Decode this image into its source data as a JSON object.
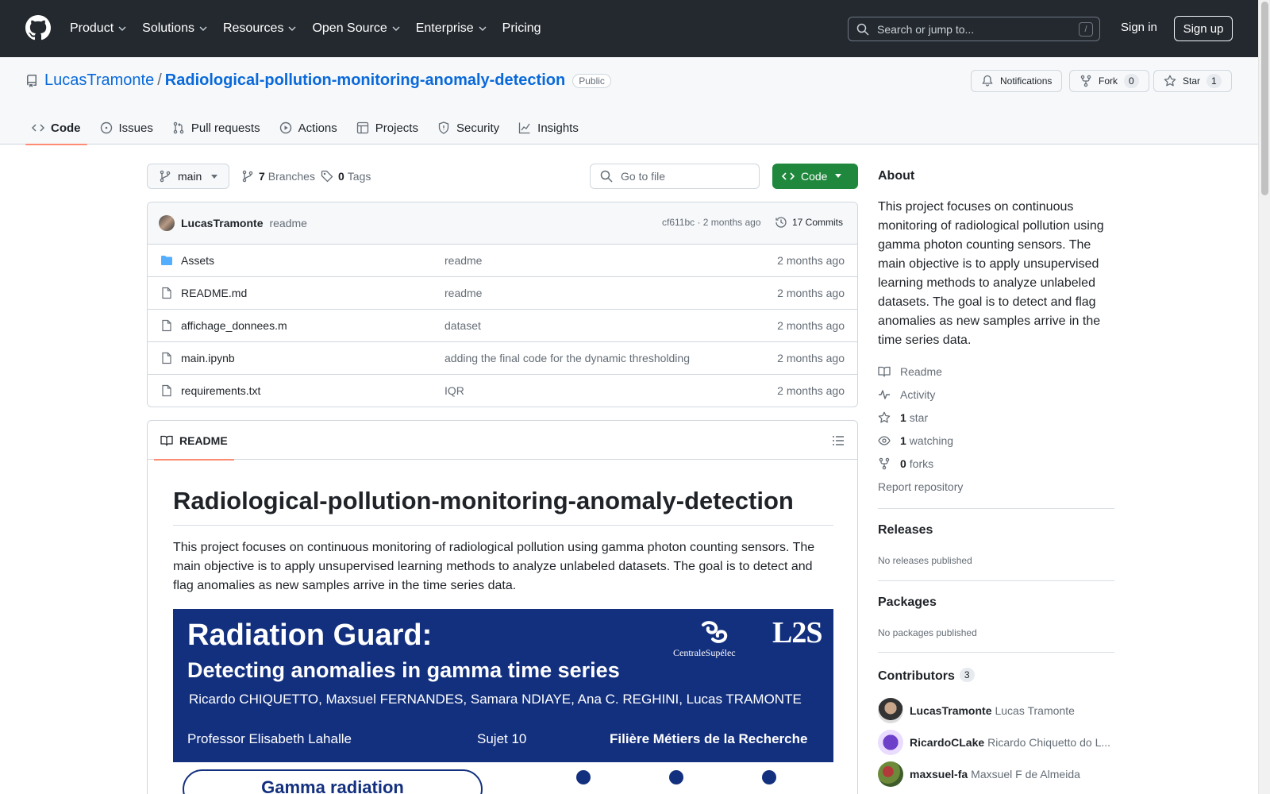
{
  "nav": {
    "items": [
      "Product",
      "Solutions",
      "Resources",
      "Open Source",
      "Enterprise",
      "Pricing"
    ],
    "search_placeholder": "Search or jump to...",
    "search_shortcut": "/",
    "signin": "Sign in",
    "signup": "Sign up"
  },
  "repo": {
    "owner": "LucasTramonte",
    "separator": "/",
    "name": "Radiological-pollution-monitoring-anomaly-detection",
    "visibility": "Public",
    "notifications_label": "Notifications",
    "fork_label": "Fork",
    "fork_count": "0",
    "star_label": "Star",
    "star_count": "1"
  },
  "tabs": [
    "Code",
    "Issues",
    "Pull requests",
    "Actions",
    "Projects",
    "Security",
    "Insights"
  ],
  "toolbar": {
    "branch": "main",
    "branches_count": "7",
    "branches_label": "Branches",
    "tags_count": "0",
    "tags_label": "Tags",
    "goto_placeholder": "Go to file",
    "code_label": "Code"
  },
  "commit": {
    "author": "LucasTramonte",
    "message": "readme",
    "hash_time": "cf611bc · 2 months ago",
    "commits_label": "17 Commits"
  },
  "files": [
    {
      "name": "Assets",
      "type": "folder",
      "message": "readme",
      "date": "2 months ago"
    },
    {
      "name": "README.md",
      "type": "file",
      "message": "readme",
      "date": "2 months ago"
    },
    {
      "name": "affichage_donnees.m",
      "type": "file",
      "message": "dataset",
      "date": "2 months ago"
    },
    {
      "name": "main.ipynb",
      "type": "file",
      "message": "adding the final code for the dynamic thresholding",
      "date": "2 months ago"
    },
    {
      "name": "requirements.txt",
      "type": "file",
      "message": "IQR",
      "date": "2 months ago"
    }
  ],
  "readme": {
    "tab_label": "README",
    "title": "Radiological-pollution-monitoring-anomaly-detection",
    "paragraph": "This project focuses on continuous monitoring of radiological pollution using gamma photon counting sensors. The main objective is to apply unsupervised learning methods to analyze unlabeled datasets. The goal is to detect and flag anomalies as new samples arrive in the time series data.",
    "banner": {
      "title": "Radiation Guard:",
      "subtitle": "Detecting anomalies in gamma time series",
      "authors": "Ricardo CHIQUETTO, Maxsuel FERNANDES, Samara NDIAYE, Ana C. REGHINI, Lucas TRAMONTE",
      "professor": "Professor Elisabeth Lahalle",
      "sujet": "Sujet 10",
      "filiere": "Filière Métiers de la Recherche",
      "logo_cs": "CentraleSupélec",
      "logo_l2s": "L2S",
      "gamma": "Gamma radiation"
    }
  },
  "about": {
    "heading": "About",
    "description": "This project focuses on continuous monitoring of radiological pollution using gamma photon counting sensors. The main objective is to apply unsupervised learning methods to analyze unlabeled datasets. The goal is to detect and flag anomalies as new samples arrive in the time series data.",
    "readme": "Readme",
    "activity": "Activity",
    "stars_count": "1",
    "stars_label": "star",
    "watching_count": "1",
    "watching_label": "watching",
    "forks_count": "0",
    "forks_label": "forks",
    "report": "Report repository"
  },
  "releases": {
    "heading": "Releases",
    "empty": "No releases published"
  },
  "packages": {
    "heading": "Packages",
    "empty": "No packages published"
  },
  "contributors": {
    "heading": "Contributors",
    "count": "3",
    "list": [
      {
        "login": "LucasTramonte",
        "name": "Lucas Tramonte"
      },
      {
        "login": "RicardoCLake",
        "name": "Ricardo Chiquetto do L..."
      },
      {
        "login": "maxsuel-fa",
        "name": "Maxsuel F de Almeida"
      }
    ]
  },
  "colors": {
    "header_bg": "#24292f",
    "link": "#0969da",
    "code_button": "#1f883d",
    "tab_underline": "#fd8c73",
    "banner_bg": "#13307f"
  }
}
